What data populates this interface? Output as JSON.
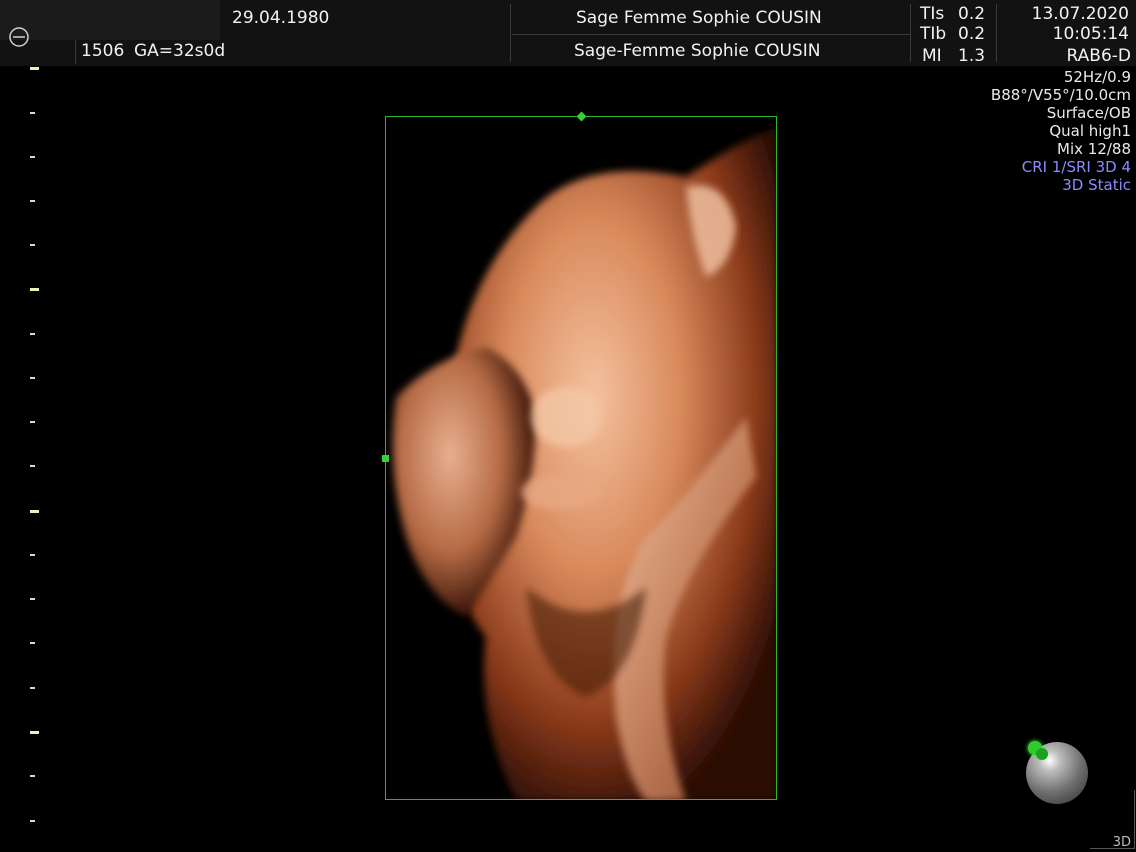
{
  "header": {
    "dob": "29.04.1980",
    "exam_id": "1506",
    "ga": "GA=32s0d",
    "examiner_1": "Sage Femme Sophie COUSIN",
    "examiner_2": "Sage-Femme Sophie COUSIN",
    "tis_label": "TIs",
    "tis_value": "0.2",
    "tib_label": "TIb",
    "tib_value": "0.2",
    "mi_label": "MI",
    "mi_value": "1.3",
    "date": "13.07.2020",
    "time": "10:05:14",
    "probe": "RAB6-D"
  },
  "params": {
    "frame_rate": "52Hz/0.9",
    "geometry": "B88°/V55°/10.0cm",
    "preset": "Surface/OB",
    "quality": "Qual high1",
    "mix": "Mix 12/88",
    "cri": "CRI 1/SRI 3D 4",
    "mode": "3D Static"
  },
  "footer": {
    "mode_tag": "3D"
  },
  "colors": {
    "roi_border": "#2fb52f",
    "param_highlight": "#8b8bff",
    "orientation_marker": "#2ecc2e",
    "background": "#000000"
  },
  "icons": {
    "probe": "probe-circle-icon",
    "orientation": "orientation-sphere-icon"
  }
}
